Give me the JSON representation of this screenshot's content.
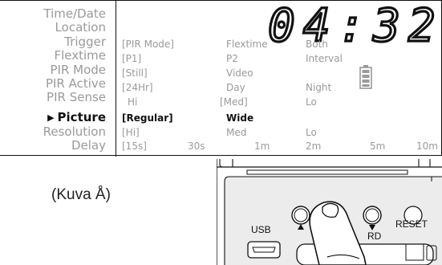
{
  "clock": {
    "time_display": "04:32"
  },
  "menu": {
    "items": [
      {
        "label": "Time/Date"
      },
      {
        "label": "Location"
      },
      {
        "label": "Trigger"
      },
      {
        "label": "Flextime"
      },
      {
        "label": "PIR Mode"
      },
      {
        "label": "PIR Active"
      },
      {
        "label": "PIR Sense"
      },
      {
        "label": "Picture",
        "active": true
      },
      {
        "label": "Resolution"
      },
      {
        "label": "Delay"
      }
    ]
  },
  "options": {
    "trigger": [
      "[PIR Mode]",
      "Flextime",
      "Both"
    ],
    "flextime": [
      "[P1]",
      "P2",
      "Interval"
    ],
    "pir_mode": [
      "[Still]",
      "Video"
    ],
    "pir_active": [
      "[24Hr]",
      "Day",
      "Night"
    ],
    "pir_sense": [
      "Hi",
      "[Med]",
      "Lo"
    ],
    "picture": [
      "[Regular]",
      "Wide"
    ],
    "resolution": [
      "[Hi]",
      "Med",
      "Lo"
    ],
    "delay": [
      "[15s]",
      "30s",
      "1m",
      "2m",
      "5m",
      "10m"
    ]
  },
  "caption": "(Kuva Å)",
  "device": {
    "usb_label": "USB",
    "rd_label": "RD",
    "reset_label": "RESET"
  },
  "icons": {
    "battery": "battery-full-icon",
    "finger": "pointing-finger-icon"
  }
}
